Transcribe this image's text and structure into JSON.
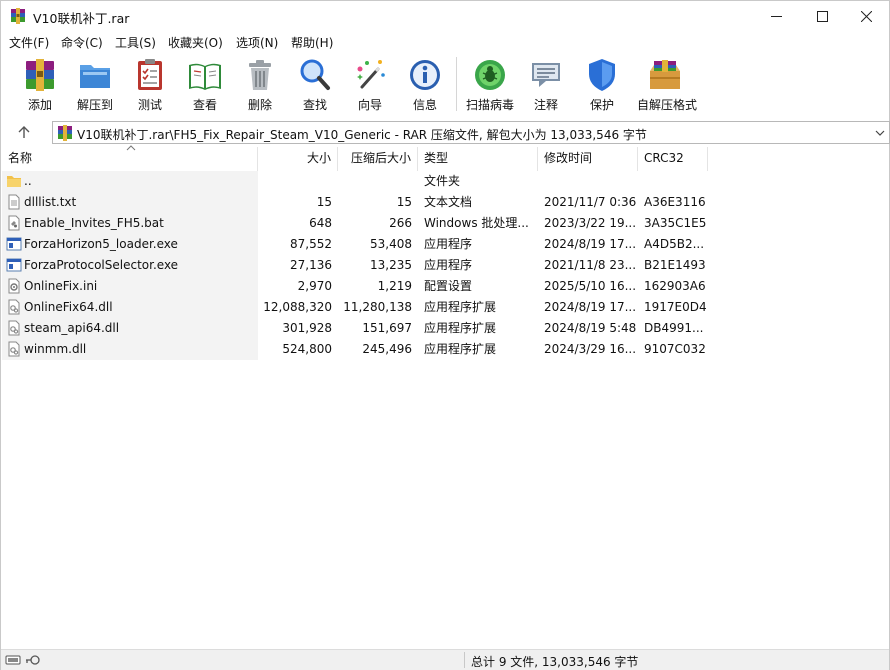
{
  "window": {
    "title": "V10联机补丁.rar",
    "controls": {
      "minimize": "—",
      "maximize": "☐",
      "close": "✕"
    }
  },
  "menu": [
    "文件(F)",
    "命令(C)",
    "工具(S)",
    "收藏夹(O)",
    "选项(N)",
    "帮助(H)"
  ],
  "toolbar": [
    {
      "label": "添加",
      "icon": "add-archive-icon"
    },
    {
      "label": "解压到",
      "icon": "extract-to-icon"
    },
    {
      "label": "测试",
      "icon": "test-icon"
    },
    {
      "label": "查看",
      "icon": "view-icon"
    },
    {
      "label": "删除",
      "icon": "delete-icon"
    },
    {
      "label": "查找",
      "icon": "find-icon"
    },
    {
      "label": "向导",
      "icon": "wizard-icon"
    },
    {
      "label": "信息",
      "icon": "info-icon"
    },
    {
      "label": "扫描病毒",
      "icon": "virus-scan-icon"
    },
    {
      "label": "注释",
      "icon": "comment-icon"
    },
    {
      "label": "保护",
      "icon": "protect-icon"
    },
    {
      "label": "自解压格式",
      "icon": "sfx-icon"
    }
  ],
  "address": {
    "path": "V10联机补丁.rar\\FH5_Fix_Repair_Steam_V10_Generic - RAR 压缩文件, 解包大小为 13,033,546 字节"
  },
  "columns": {
    "name": "名称",
    "size": "大小",
    "packed": "压缩后大小",
    "type": "类型",
    "modified": "修改时间",
    "crc": "CRC32"
  },
  "files": [
    {
      "name": "..",
      "size": "",
      "packed": "",
      "type": "文件夹",
      "modified": "",
      "crc": "",
      "icon": "folder-icon"
    },
    {
      "name": "dlllist.txt",
      "size": "15",
      "packed": "15",
      "type": "文本文档",
      "modified": "2021/11/7 0:36",
      "crc": "A36E3116",
      "icon": "text-file-icon"
    },
    {
      "name": "Enable_Invites_FH5.bat",
      "size": "648",
      "packed": "266",
      "type": "Windows 批处理...",
      "modified": "2023/3/22 19...",
      "crc": "3A35C1E5",
      "icon": "batch-file-icon"
    },
    {
      "name": "ForzaHorizon5_loader.exe",
      "size": "87,552",
      "packed": "53,408",
      "type": "应用程序",
      "modified": "2024/8/19 17...",
      "crc": "A4D5B2...",
      "icon": "exe-file-icon"
    },
    {
      "name": "ForzaProtocolSelector.exe",
      "size": "27,136",
      "packed": "13,235",
      "type": "应用程序",
      "modified": "2021/11/8 23...",
      "crc": "B21E1493",
      "icon": "exe-file-icon"
    },
    {
      "name": "OnlineFix.ini",
      "size": "2,970",
      "packed": "1,219",
      "type": "配置设置",
      "modified": "2025/5/10 16...",
      "crc": "162903A6",
      "icon": "ini-file-icon"
    },
    {
      "name": "OnlineFix64.dll",
      "size": "12,088,320",
      "packed": "11,280,138",
      "type": "应用程序扩展",
      "modified": "2024/8/19 17...",
      "crc": "1917E0D4",
      "icon": "dll-file-icon"
    },
    {
      "name": "steam_api64.dll",
      "size": "301,928",
      "packed": "151,697",
      "type": "应用程序扩展",
      "modified": "2024/8/19 5:48",
      "crc": "DB4991...",
      "icon": "dll-file-icon"
    },
    {
      "name": "winmm.dll",
      "size": "524,800",
      "packed": "245,496",
      "type": "应用程序扩展",
      "modified": "2024/3/29 16...",
      "crc": "9107C032",
      "icon": "dll-file-icon"
    }
  ],
  "status": {
    "summary": "总计 9 文件, 13,033,546 字节"
  },
  "colors": {
    "row_name_bg": "#f3f3f3",
    "status_bg": "#f0f0f0",
    "accent_blue": "#2a6fd6"
  }
}
